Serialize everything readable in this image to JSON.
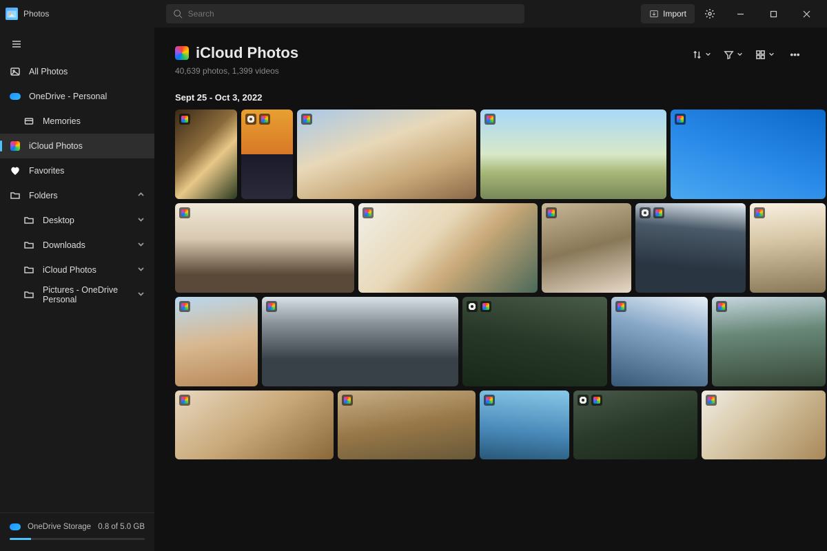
{
  "titlebar": {
    "app_name": "Photos",
    "search_placeholder": "Search",
    "import_label": "Import"
  },
  "sidebar": {
    "items": [
      {
        "label": "All Photos"
      },
      {
        "label": "OneDrive - Personal"
      },
      {
        "label": "Memories"
      },
      {
        "label": "iCloud Photos"
      },
      {
        "label": "Favorites"
      },
      {
        "label": "Folders"
      },
      {
        "label": "Desktop"
      },
      {
        "label": "Downloads"
      },
      {
        "label": "iCloud Photos"
      },
      {
        "label": "Pictures - OneDrive Personal"
      }
    ],
    "storage_label": "OneDrive Storage",
    "storage_value": "0.8 of 5.0 GB"
  },
  "main": {
    "title": "iCloud Photos",
    "subtitle": "40,639 photos, 1,399 videos",
    "date_range": "Sept 25 - Oct 3, 2022"
  },
  "tiles": {
    "r1": [
      {
        "bg": "linear-gradient(135deg,#3a2a18,#8a6a3a 40%,#e8c888 60%,#2a3a20)"
      },
      {
        "bg": "linear-gradient(180deg,#e8a030 0%,#d87828 50%,#1a1a2a 50%,#2a2a3a)"
      },
      {
        "bg": "linear-gradient(160deg,#a8c8e8 0%,#e8d8b8 40%,#c8a878 70%,#8a6848)"
      },
      {
        "bg": "linear-gradient(180deg,#a8d8f8 0%,#d8e8c8 50%,#a8b878 70%,#788858)"
      },
      {
        "bg": "linear-gradient(200deg,#0a68c8 0%,#2888e8 50%,#4aa8f0)"
      }
    ],
    "r2": [
      {
        "bg": "linear-gradient(180deg,#f0e8d8 0%,#d8c8b0 40%,#5a4838 80%)"
      },
      {
        "bg": "linear-gradient(135deg,#f0f0e8,#e8d8b8 40%,#c8a878 60%,#4a6858)"
      },
      {
        "bg": "linear-gradient(165deg,#c8b898,#887858 50%,#e8d8c8)"
      },
      {
        "bg": "linear-gradient(185deg,#e8f0f8 0%,#4a5a68 30%,#2a3542 70%)"
      },
      {
        "bg": "linear-gradient(175deg,#f8f0e0 0%,#d8c8a8 40%,#887858)"
      }
    ],
    "r3": [
      {
        "bg": "linear-gradient(170deg,#b8d8f0 0%,#d8b890 50%,#b88858)"
      },
      {
        "bg": "linear-gradient(180deg,#d8e0e8 0%,#889098 30%,#384048 70%)"
      },
      {
        "bg": "linear-gradient(190deg,#485a48,#283828 50%,#182818)"
      },
      {
        "bg": "linear-gradient(195deg,#e8f0f8 0%,#88a8c8 40%,#385878)"
      },
      {
        "bg": "linear-gradient(175deg,#c8d8e0 0%,#688878 40%,#384838)"
      }
    ],
    "r4": [
      {
        "bg": "linear-gradient(145deg,#e8d8c0,#c8a878 50%,#886838)"
      },
      {
        "bg": "linear-gradient(170deg,#c8b088,#987848 50%,#685838)"
      },
      {
        "bg": "linear-gradient(185deg,#88c8e8,#4888b8 60%,#285878)"
      },
      {
        "bg": "linear-gradient(165deg,#4a5a4a,#2a3a2a 50%,#1a281a)"
      },
      {
        "bg": "linear-gradient(135deg,#f0ece4,#d8c8a8 40%,#a88858)"
      }
    ]
  }
}
